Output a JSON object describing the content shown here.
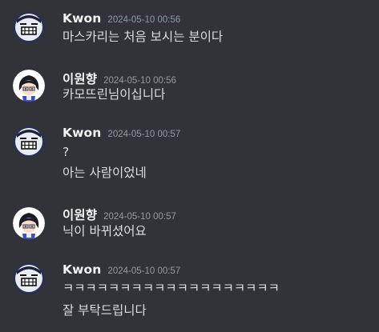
{
  "messages": [
    {
      "author": "Kwon",
      "timestamp": "2024-05-10 00:56",
      "lines": [
        "마스카리는 처음 보시는 분이다"
      ]
    },
    {
      "author": "이원향",
      "timestamp": "2024-05-10 00:56",
      "lines": [
        "카모뜨린님이십니다"
      ]
    },
    {
      "author": "Kwon",
      "timestamp": "2024-05-10 00:57",
      "lines": [
        "?",
        "아는 사람이었네"
      ]
    },
    {
      "author": "이원향",
      "timestamp": "2024-05-10 00:57",
      "lines": [
        "닉이 바뀌셨어요"
      ]
    },
    {
      "author": "Kwon",
      "timestamp": "2024-05-10 00:57",
      "lines": [
        "ㅋㅋㅋㅋㅋㅋㅋㅋㅋㅋㅋㅋㅋㅋㅋㅋㅋㅋㅋ",
        "잘 부탁드립니다"
      ]
    }
  ],
  "colors": {
    "background": "#313338",
    "username": "#f2f3f5",
    "timestamp": "#949ba4",
    "message_text": "#dbdee1"
  },
  "icons": {
    "kwon_avatar": "meme-face-avatar-icon",
    "wonhyang_avatar": "anime-character-avatar-icon"
  }
}
